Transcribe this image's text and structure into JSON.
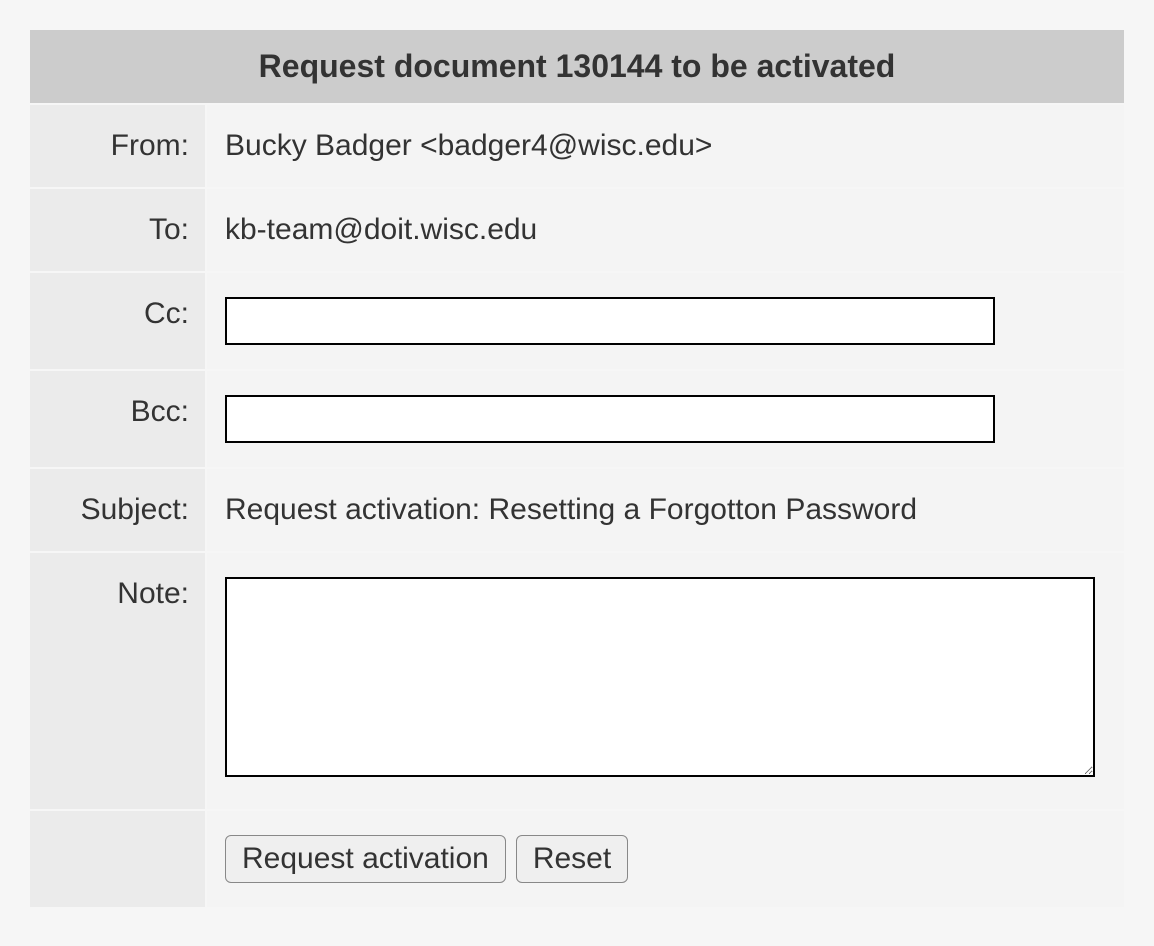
{
  "header": {
    "title": "Request document 130144 to be activated"
  },
  "fields": {
    "from": {
      "label": "From:",
      "value": "Bucky Badger <badger4@wisc.edu>"
    },
    "to": {
      "label": "To:",
      "value": "kb-team@doit.wisc.edu"
    },
    "cc": {
      "label": "Cc:",
      "value": ""
    },
    "bcc": {
      "label": "Bcc:",
      "value": ""
    },
    "subject": {
      "label": "Subject:",
      "value": "Request activation: Resetting a Forgotton Password"
    },
    "note": {
      "label": "Note:",
      "value": ""
    }
  },
  "buttons": {
    "submit": "Request activation",
    "reset": "Reset"
  }
}
